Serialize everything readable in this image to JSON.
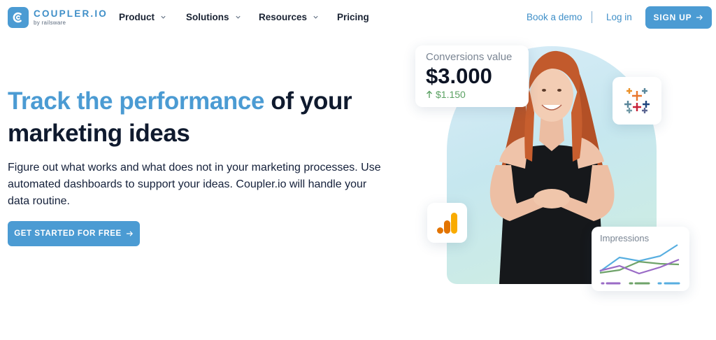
{
  "brand": {
    "name": "COUPLER.IO",
    "sub": "by railsware",
    "color": "#4b9bd3"
  },
  "nav": {
    "items": [
      {
        "label": "Product",
        "has_dropdown": true
      },
      {
        "label": "Solutions",
        "has_dropdown": true
      },
      {
        "label": "Resources",
        "has_dropdown": true
      },
      {
        "label": "Pricing",
        "has_dropdown": false
      }
    ],
    "book_demo": "Book a demo",
    "login": "Log in",
    "signup": "SIGN UP"
  },
  "hero": {
    "headline_accent": "Track the performance",
    "headline_rest_1": " of your",
    "headline_rest_2": "marketing ideas",
    "description": "Figure out what works and what does not in your marketing processes. Use automated dashboards to support your ideas. Coupler.io will handle your data routine.",
    "cta": "GET STARTED FOR FREE"
  },
  "cards": {
    "conversions": {
      "label": "Conversions value",
      "value": "$3.000",
      "delta": "$1.150",
      "delta_color": "#5ba163"
    },
    "impressions": {
      "label": "Impressions"
    }
  },
  "icons": {
    "logo": "coupler-logo-icon",
    "tableau": "tableau-icon",
    "google_analytics": "google-analytics-icon",
    "arrow": "arrow-right-icon",
    "chevron": "chevron-down-icon"
  }
}
